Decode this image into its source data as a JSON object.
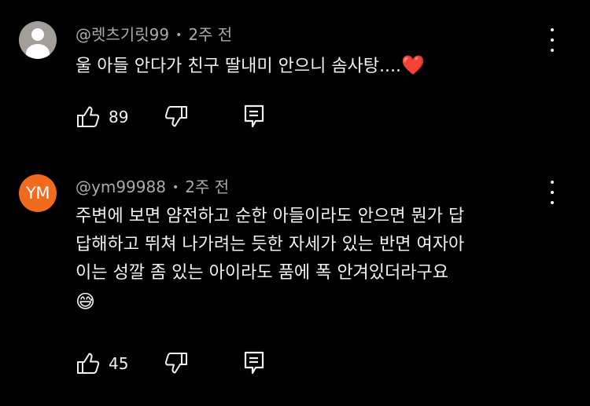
{
  "comments": [
    {
      "author": "@렛츠기릿99",
      "time": "2주 전",
      "text": "울 아들 안다가 친구 딸내미 안으니 솜사탕....",
      "emoji": "❤️",
      "avatar": {
        "type": "default",
        "initials": ""
      },
      "likes": "89"
    },
    {
      "author": "@ym99988",
      "time": "2주 전",
      "text_lines": [
        "주변에 보면 얌전하고 순한 아들이라도 안으면 뭔가 답",
        "답해하고 뛰쳐 나가려는 듯한 자세가 있는 반면 여자아",
        "이는 성깔 좀 있는 아이라도 품에 폭 안겨있더라구요"
      ],
      "emoji": "😅",
      "avatar": {
        "type": "initials",
        "initials": "YM",
        "color": "#f26b1d"
      },
      "likes": "45"
    }
  ],
  "meta_separator": "•",
  "colors": {
    "background": "#000000",
    "text": "#f1f1f1",
    "meta": "#aaaaaa"
  }
}
